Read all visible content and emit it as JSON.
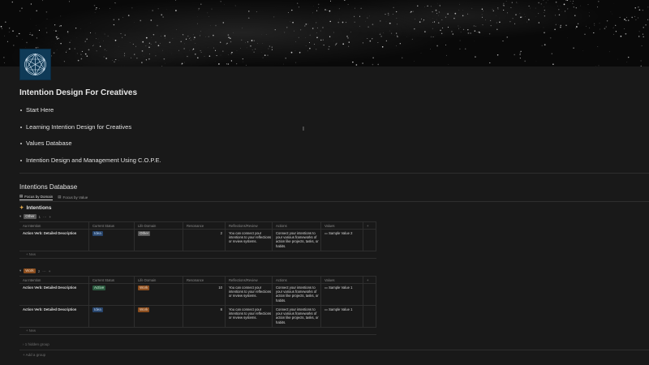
{
  "page": {
    "title": "Intention Design For Creatives",
    "links": [
      "Start Here",
      "Learning Intention Design for Creatives",
      "Values Database",
      "Intention Design and Management Using C.O.P.E."
    ]
  },
  "database": {
    "title": "Intentions Database",
    "views": [
      "Focus by Domain",
      "Focus by Value"
    ],
    "section_title": "Intentions",
    "columns": [
      "Aa Intention",
      "Current Status",
      "Life Domain",
      "Resonance",
      "Reflections/Review",
      "Actions",
      "Values",
      "+"
    ],
    "groups": [
      {
        "label": "Other",
        "count": "1",
        "rows": [
          {
            "name": "Action Verb: Detailed Description",
            "status": "Idea",
            "domain": "Other",
            "resonance": "2",
            "reflections": "You can connect your intentions to your reflections or review systems.",
            "actions": "Connect your intentions to your various frameworks of action like projects, tasks, or habits.",
            "values": "Sample Value 2"
          }
        ]
      },
      {
        "label": "Work",
        "count": "2",
        "rows": [
          {
            "name": "Action Verb: Detailed Description",
            "status": "Active",
            "domain": "Work",
            "resonance": "10",
            "reflections": "You can connect your intentions to your reflections or review systems.",
            "actions": "Connect your intentions to your various frameworks of action like projects, tasks, or habits.",
            "values": "Sample Value 1"
          },
          {
            "name": "Action Verb: Detailed Description",
            "status": "Idea",
            "domain": "Work",
            "resonance": "8",
            "reflections": "You can connect your intentions to your reflections or review systems.",
            "actions": "Connect your intentions to your various frameworks of action like projects, tasks, or habits.",
            "values": "Sample Value 1"
          }
        ]
      }
    ],
    "new_label": "New",
    "hidden_group": "1 hidden group",
    "add_group": "Add a group"
  },
  "colors": {
    "background": "#191919",
    "icon_bg": "#0f3a57"
  }
}
